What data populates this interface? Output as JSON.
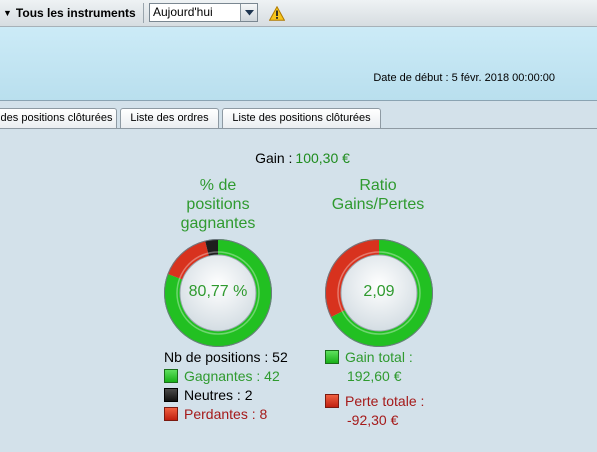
{
  "toolbar": {
    "instrument_label": "Tous les instruments",
    "period_select": "Aujourd'hui",
    "icons": {
      "dropdown": "triangle-down-icon",
      "period_dropdown": "chevron-down-icon",
      "warning": "warning-icon"
    }
  },
  "header": {
    "start_date_label": "Date de début :",
    "start_date_value": "5 févr. 2018 00:00:00"
  },
  "tabs": [
    {
      "label": "des positions clôturées"
    },
    {
      "label": "Liste des ordres"
    },
    {
      "label": "Liste des positions clôturées"
    }
  ],
  "summary": {
    "gain_label": "Gain :",
    "gain_value": "100,30 €"
  },
  "win_chart": {
    "title_lines": [
      "% de",
      "positions",
      "gagnantes"
    ],
    "center_value": "80,77 %",
    "total_label": "Nb de positions : 52",
    "legend": [
      {
        "label": "Gagnantes : 42",
        "count": 42,
        "color": "#22c022"
      },
      {
        "label": "Neutres : 2",
        "count": 2,
        "color": "#1e1e1e"
      },
      {
        "label": "Perdantes : 8",
        "count": 8,
        "color": "#d8321e"
      }
    ]
  },
  "ratio_chart": {
    "title_lines": [
      "Ratio",
      "Gains/Pertes"
    ],
    "center_value": "2,09",
    "legend": [
      {
        "label_line1": "Gain total :",
        "label_line2": "192,60 €",
        "amount": 192.6,
        "color": "#22c022"
      },
      {
        "label_line1": "Perte totale :",
        "label_line2": "-92,30 €",
        "amount": 92.3,
        "color": "#d8321e"
      }
    ]
  }
}
